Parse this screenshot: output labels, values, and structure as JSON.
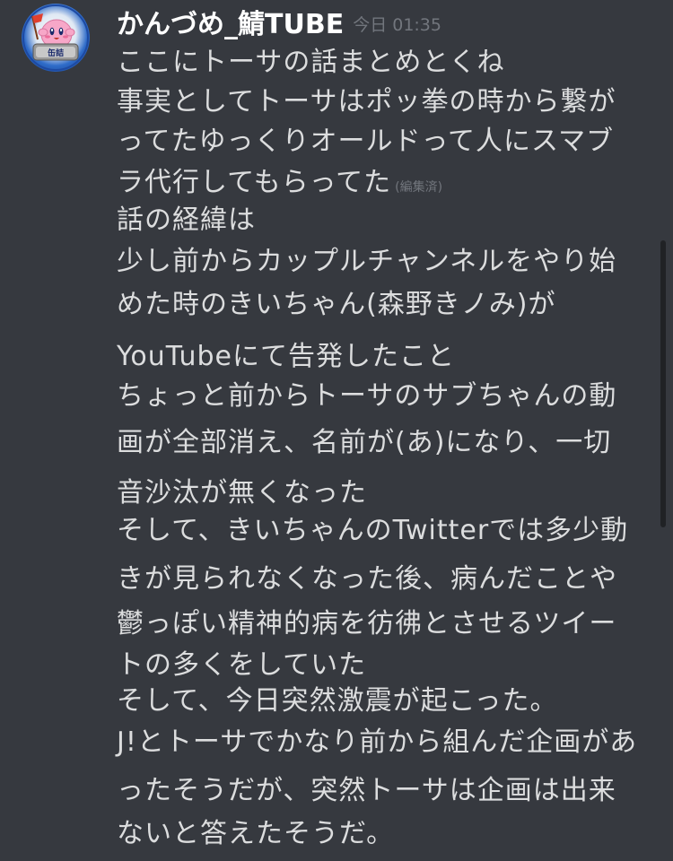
{
  "message": {
    "username": "かんづめ_鯖TUBE",
    "timestamp": "今日 01:35",
    "avatar_icon": "pink-character-avatar-icon",
    "avatar_badge_text": "缶詰",
    "edited_label": "(編集済)",
    "lines": [
      "ここにトーサの話まとめとくね",
      "事実としてトーサはポッ拳の時から繋が",
      "ってたゆっくりオールドって人にスマブ",
      "ラ代行してもらってた",
      "話の経緯は",
      "少し前からカップルチャンネルをやり始",
      "めた時のきいちゃん(森野きノみ)が",
      "YouTubeにて告発したこと",
      "ちょっと前からトーサのサブちゃんの動",
      "画が全部消え、名前が(あ)になり、一切",
      "音沙汰が無くなった",
      "そして、きいちゃんのTwitterでは多少動",
      "きが見られなくなった後、病んだことや",
      "鬱っぽい精神的病を彷彿とさせるツイー",
      "トの多くをしていた",
      "そして、今日突然激震が起こった。",
      "J!とトーサでかなり前から組んだ企画があ",
      "ったそうだが、突然トーサは企画は出来",
      "ないと答えたそうだ。"
    ]
  },
  "colors": {
    "background": "#36393f",
    "username": "#ffffff",
    "text": "#dcddde",
    "muted": "#72767d",
    "scrollbar": "#202225"
  }
}
